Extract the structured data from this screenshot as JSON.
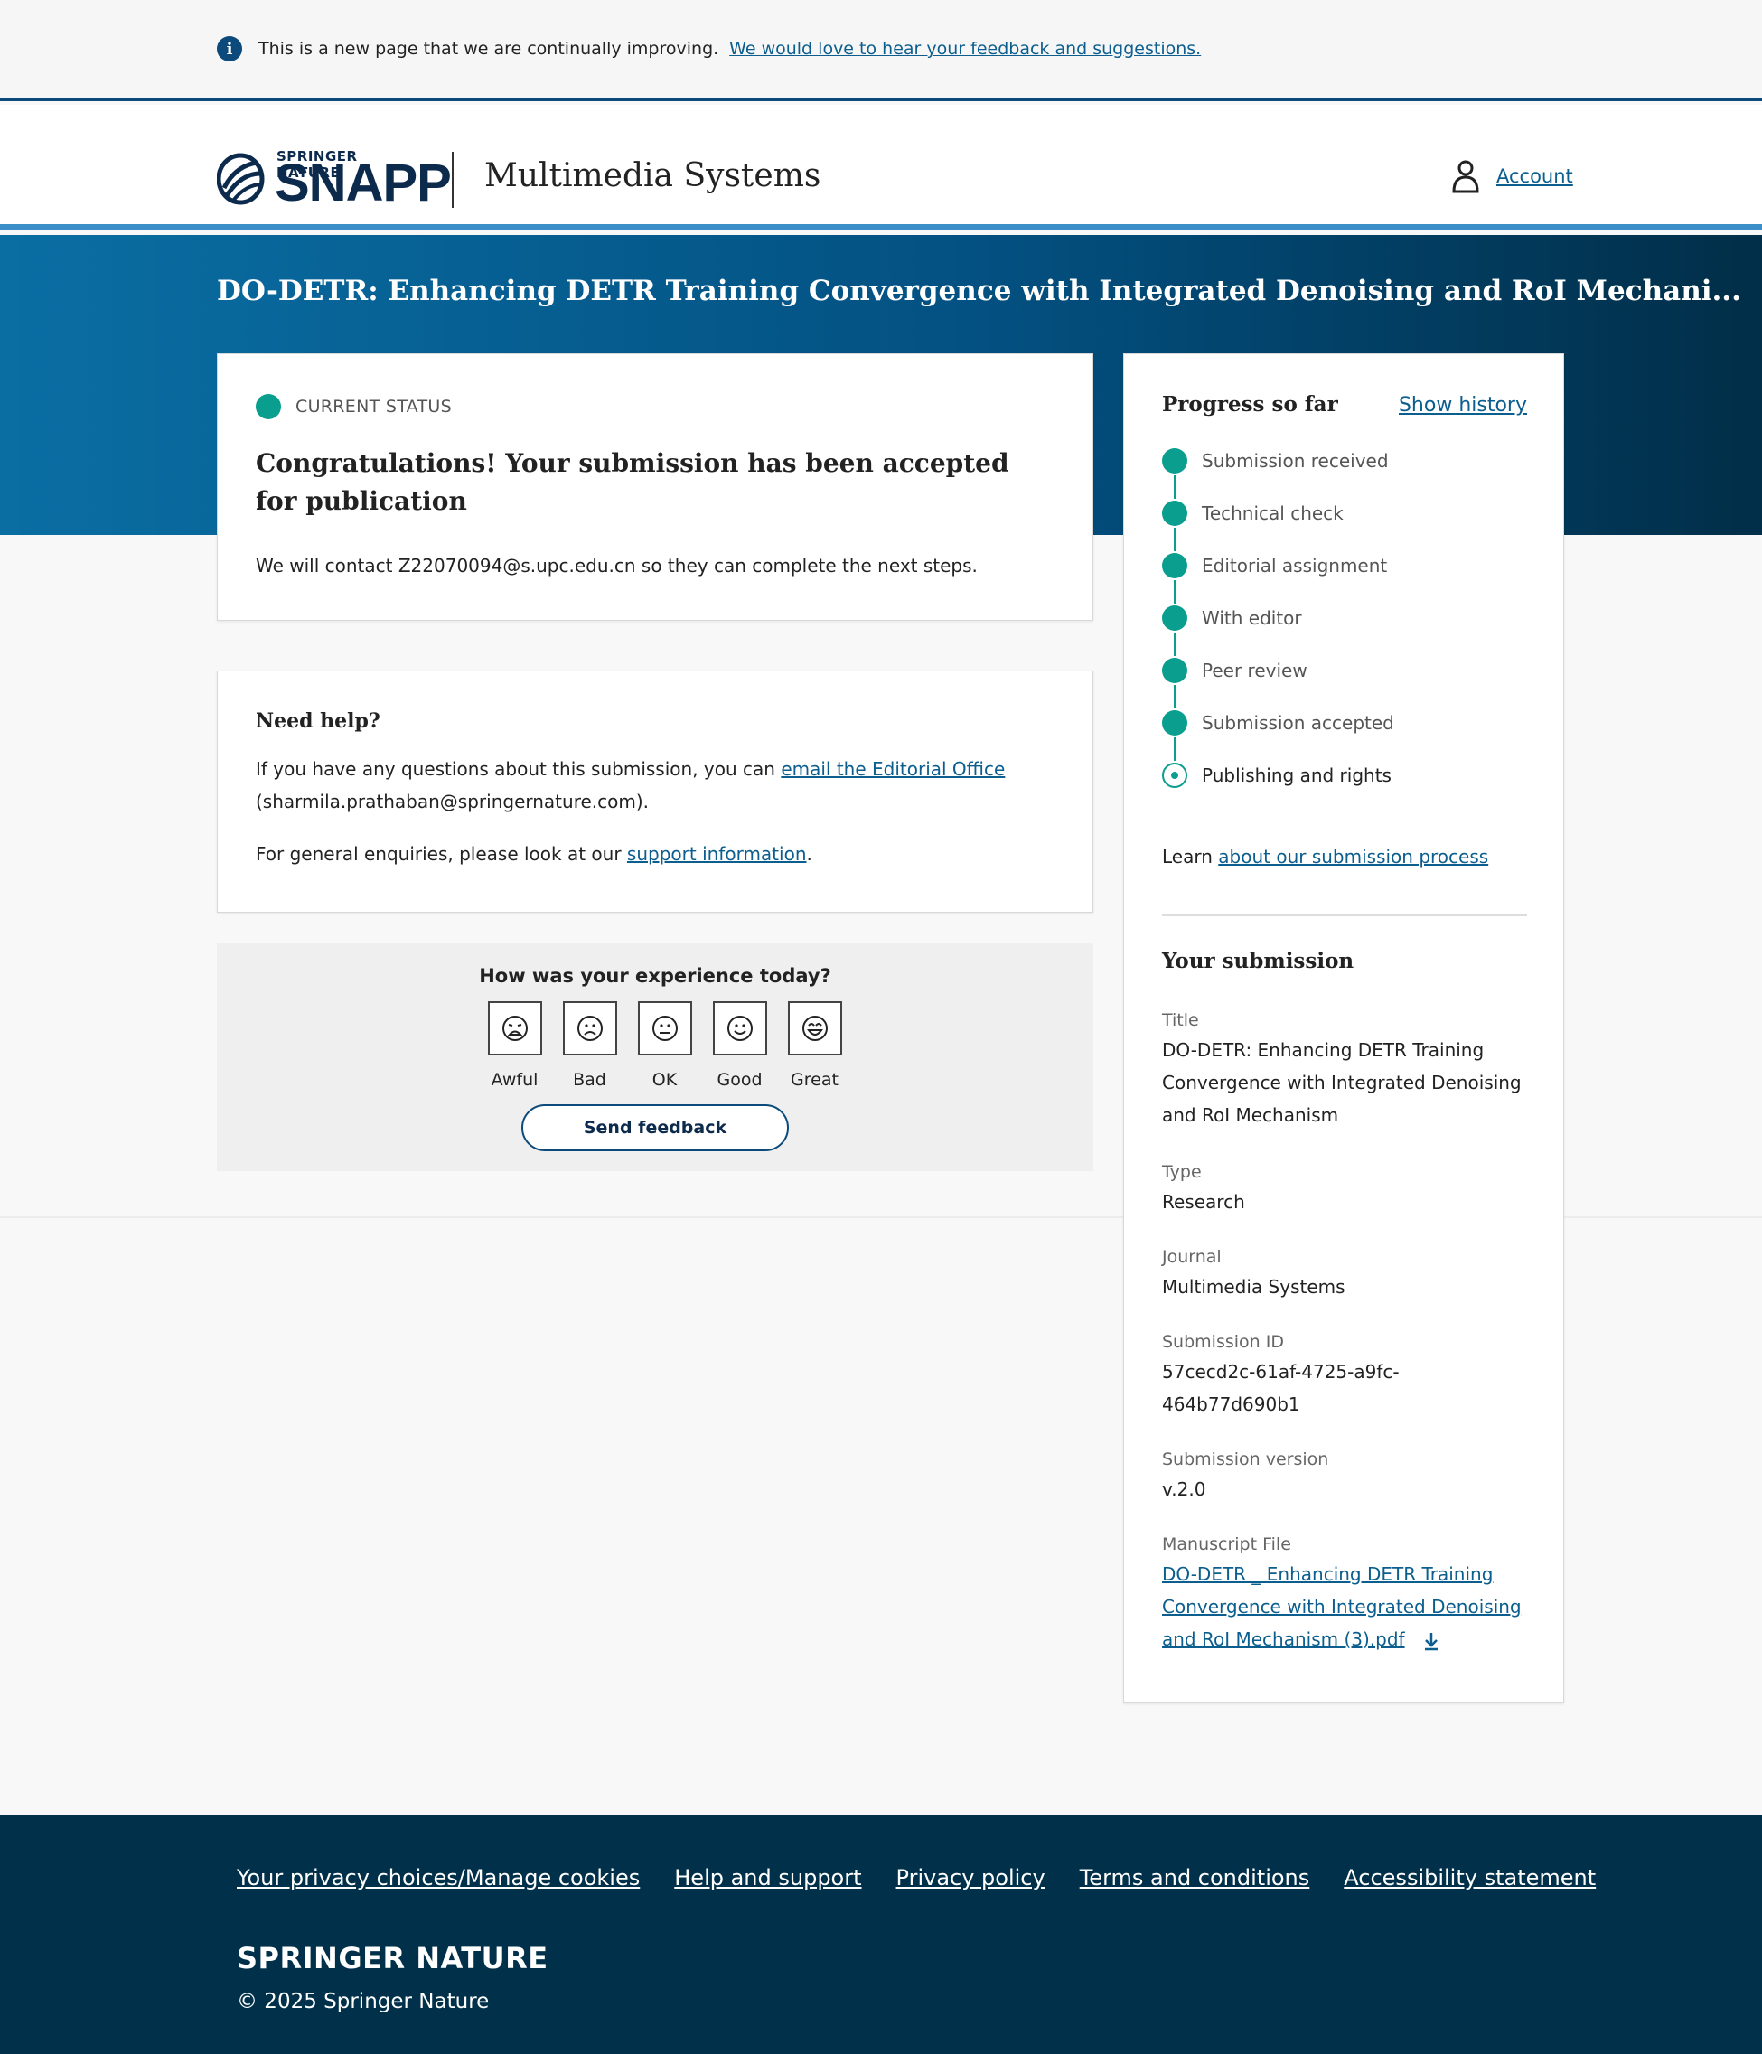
{
  "notice": {
    "message": "This is a new page that we are continually improving.",
    "link": "We would love to hear your feedback and suggestions."
  },
  "header": {
    "brand_top": "SPRINGER NATURE",
    "brand_main": "SNAPP",
    "journal": "Multimedia Systems",
    "account_label": "Account"
  },
  "hero": {
    "title": "DO-DETR: Enhancing DETR Training Convergence with Integrated Denoising and RoI Mechani..."
  },
  "status": {
    "label": "CURRENT STATUS",
    "title": "Congratulations! Your submission has been accepted for publication",
    "text": "We will contact Z22070094@s.upc.edu.cn so they can complete the next steps."
  },
  "help": {
    "heading": "Need help?",
    "line1_prefix": "If you have any questions about this submission, you can ",
    "line1_link": "email the Editorial Office",
    "line1_suffix": "(sharmila.prathaban@springernature.com).",
    "line2_prefix": "For general enquiries, please look at our ",
    "line2_link": "support information",
    "line2_suffix": "."
  },
  "feedback": {
    "question": "How was your experience today?",
    "options": [
      "Awful",
      "Bad",
      "OK",
      "Good",
      "Great"
    ],
    "send_label": "Send feedback"
  },
  "progress": {
    "heading": "Progress so far",
    "history_link": "Show history",
    "steps": [
      {
        "label": "Submission received",
        "state": "done"
      },
      {
        "label": "Technical check",
        "state": "done"
      },
      {
        "label": "Editorial assignment",
        "state": "done"
      },
      {
        "label": "With editor",
        "state": "done"
      },
      {
        "label": "Peer review",
        "state": "done"
      },
      {
        "label": "Submission accepted",
        "state": "done"
      },
      {
        "label": "Publishing and rights",
        "state": "current"
      }
    ],
    "learn_prefix": "Learn ",
    "learn_link": "about our submission process"
  },
  "submission": {
    "heading": "Your submission",
    "title_label": "Title",
    "title_value": "DO-DETR: Enhancing DETR Training Convergence with Integrated Denoising and RoI Mechanism",
    "type_label": "Type",
    "type_value": "Research",
    "journal_label": "Journal",
    "journal_value": "Multimedia Systems",
    "id_label": "Submission ID",
    "id_value": "57cecd2c-61af-4725-a9fc-464b77d690b1",
    "version_label": "Submission version",
    "version_value": "v.2.0",
    "file_label": "Manuscript File",
    "file_value": "DO-DETR _ Enhancing DETR Training Convergence with Integrated Denoising and RoI Mechanism (3).pdf"
  },
  "footer": {
    "links": [
      "Your privacy choices/Manage cookies",
      "Help and support",
      "Privacy policy",
      "Terms and conditions",
      "Accessibility statement"
    ],
    "brand": "SPRINGER NATURE",
    "copyright": "© 2025 Springer Nature"
  },
  "colors": {
    "accent_teal": "#0a9e8e",
    "link_blue": "#0b5e8e",
    "navy": "#01304a"
  }
}
